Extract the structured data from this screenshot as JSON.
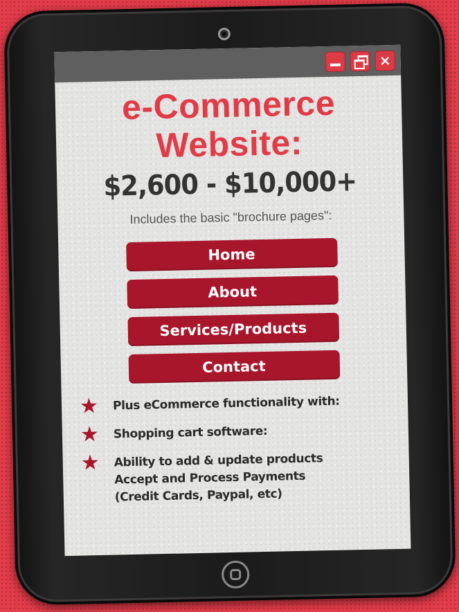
{
  "window": {
    "controls": [
      {
        "name": "minimize",
        "icon": "minimize-icon"
      },
      {
        "name": "restore",
        "icon": "restore-icon"
      },
      {
        "name": "close",
        "icon": "close-icon",
        "glyph": "×"
      }
    ]
  },
  "hero": {
    "title_line1": "e-Commerce",
    "title_line2": "Website:",
    "price": "$2,600 - $10,000+",
    "subtitle": "Includes the basic \"brochure pages\":"
  },
  "nav": {
    "items": [
      {
        "label": "Home"
      },
      {
        "label": "About"
      },
      {
        "label": "Services/Products"
      },
      {
        "label": "Contact"
      }
    ]
  },
  "features": {
    "bullet_icon": "star-icon",
    "items": [
      {
        "lines": [
          "Plus eCommerce functionality with:"
        ]
      },
      {
        "lines": [
          "Shopping cart software:"
        ]
      },
      {
        "lines": [
          "Ability to add & update products",
          "Accept and Process Payments",
          "(Credit Cards, Paypal, etc)"
        ]
      }
    ]
  },
  "colors": {
    "background": "#e23d4a",
    "accent_red": "#e13b47",
    "button_red": "#a8162c",
    "title_bar": "#5f5f5f",
    "screen": "#e4e4e2"
  }
}
